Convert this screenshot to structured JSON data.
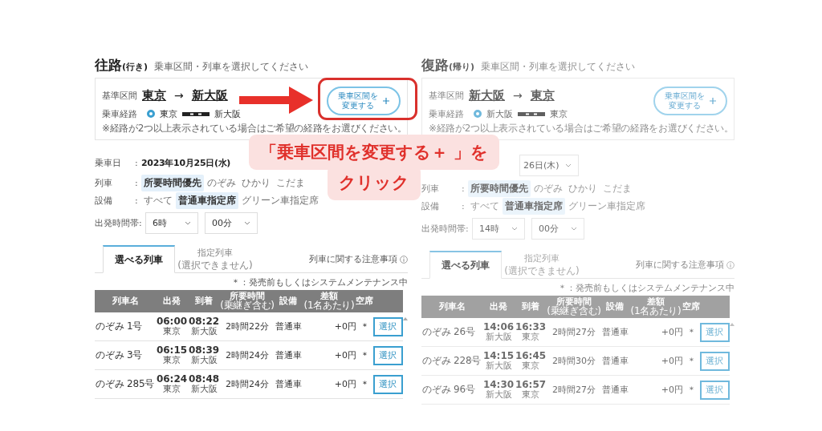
{
  "panels": [
    {
      "title": "往路",
      "title_sub": "(行き)",
      "instruction": "乗車区間・列車を選択してください",
      "dimmed": false,
      "separator": ":",
      "route": {
        "label": "基準区間",
        "from": "東京",
        "arrow": "→",
        "to": "新大阪",
        "change_button": [
          "乗車区間を",
          "変更する"
        ]
      },
      "path": {
        "label": "乗車経路",
        "selected": true,
        "from": "東京",
        "to": "新大阪",
        "note": "※経路が2つ以上表示されている場合はご希望の経路をお選びください。"
      },
      "date": {
        "label": "乗車日",
        "kind": "text",
        "value": "2023年10月25日(水)"
      },
      "trains": {
        "label": "列車",
        "options": [
          {
            "label": "所要時間優先",
            "selected": true
          },
          {
            "label": "のぞみ",
            "selected": false
          },
          {
            "label": "ひかり",
            "selected": false
          },
          {
            "label": "こだま",
            "selected": false
          }
        ]
      },
      "facility": {
        "label": "設備",
        "options": [
          {
            "label": "すべて",
            "selected": false
          },
          {
            "label": "普通車指定席",
            "selected": true
          },
          {
            "label": "グリーン車指定席",
            "selected": false
          }
        ]
      },
      "time": {
        "label": "出発時間帯",
        "hour": "6時",
        "minute": "00分"
      },
      "tabs": [
        {
          "label": "選べる列車",
          "selected": true
        },
        {
          "label": "指定列車",
          "sub": "(選択できません)",
          "selected": false
        }
      ],
      "notice_link": "列車に関する注意事項",
      "legend": "＊：発売前もしくはシステムメンテナンス中",
      "columns": [
        {
          "label": "列車名"
        },
        {
          "label": "出発"
        },
        {
          "label": "到着"
        },
        {
          "label": "所要時間",
          "sub": "(乗継ぎ含む)"
        },
        {
          "label": "設備"
        },
        {
          "label": "差額",
          "sub": "(1名あたり)"
        },
        {
          "label": "空席"
        }
      ],
      "rows": [
        {
          "name": "のぞみ 1号",
          "dep": "06:00",
          "dep_station": "東京",
          "arr": "08:22",
          "arr_station": "新大阪",
          "duration": "2時間22分",
          "seat_class": "普通車",
          "price": "+0円",
          "vacancy": "＊",
          "action": "選択"
        },
        {
          "name": "のぞみ 3号",
          "dep": "06:15",
          "dep_station": "東京",
          "arr": "08:39",
          "arr_station": "新大阪",
          "duration": "2時間24分",
          "seat_class": "普通車",
          "price": "+0円",
          "vacancy": "＊",
          "action": "選択"
        },
        {
          "name": "のぞみ 285号",
          "dep": "06:24",
          "dep_station": "東京",
          "arr": "08:48",
          "arr_station": "新大阪",
          "duration": "2時間24分",
          "seat_class": "普通車",
          "price": "+0円",
          "vacancy": "＊",
          "action": "選択"
        }
      ]
    },
    {
      "title": "復路",
      "title_sub": "(帰り)",
      "instruction": "乗車区間・列車を選択してください",
      "dimmed": true,
      "separator": ":",
      "route": {
        "label": "基準区間",
        "from": "新大阪",
        "arrow": "→",
        "to": "東京",
        "change_button": [
          "乗車区間を",
          "変更する"
        ]
      },
      "path": {
        "label": "乗車経路",
        "selected": true,
        "from": "新大阪",
        "to": "東京",
        "note": "※経路が2つ以上表示されている場合はご希望の経路をお選びください。"
      },
      "date": {
        "kind": "select",
        "value": "26日(木)"
      },
      "trains": {
        "label": "列車",
        "options": [
          {
            "label": "所要時間優先",
            "selected": true
          },
          {
            "label": "のぞみ",
            "selected": false
          },
          {
            "label": "ひかり",
            "selected": false
          },
          {
            "label": "こだま",
            "selected": false
          }
        ]
      },
      "facility": {
        "label": "設備",
        "options": [
          {
            "label": "すべて",
            "selected": false
          },
          {
            "label": "普通車指定席",
            "selected": true
          },
          {
            "label": "グリーン車指定席",
            "selected": false
          }
        ]
      },
      "time": {
        "label": "出発時間帯",
        "hour": "14時",
        "minute": "00分"
      },
      "tabs": [
        {
          "label": "選べる列車",
          "selected": true
        },
        {
          "label": "指定列車",
          "sub": "(選択できません)",
          "selected": false
        }
      ],
      "notice_link": "列車に関する注意事項",
      "legend": "＊：発売前もしくはシステムメンテナンス中",
      "columns": [
        {
          "label": "列車名"
        },
        {
          "label": "出発"
        },
        {
          "label": "到着"
        },
        {
          "label": "所要時間",
          "sub": "(乗継ぎ含む)"
        },
        {
          "label": "設備"
        },
        {
          "label": "差額",
          "sub": "(1名あたり)"
        },
        {
          "label": "空席"
        }
      ],
      "rows": [
        {
          "name": "のぞみ 26号",
          "dep": "14:06",
          "dep_station": "新大阪",
          "arr": "16:33",
          "arr_station": "東京",
          "duration": "2時間27分",
          "seat_class": "普通車",
          "price": "+0円",
          "vacancy": "＊",
          "action": "選択"
        },
        {
          "name": "のぞみ 228号",
          "dep": "14:15",
          "dep_station": "新大阪",
          "arr": "16:45",
          "arr_station": "東京",
          "duration": "2時間30分",
          "seat_class": "普通車",
          "price": "+0円",
          "vacancy": "＊",
          "action": "選択"
        },
        {
          "name": "のぞみ 96号",
          "dep": "14:30",
          "dep_station": "新大阪",
          "arr": "16:57",
          "arr_station": "東京",
          "duration": "2時間27分",
          "seat_class": "普通車",
          "price": "+0円",
          "vacancy": "＊",
          "action": "選択"
        }
      ]
    }
  ],
  "annotation": {
    "callout": [
      "「乗車区間を変更する＋ 」を",
      "クリック"
    ]
  }
}
